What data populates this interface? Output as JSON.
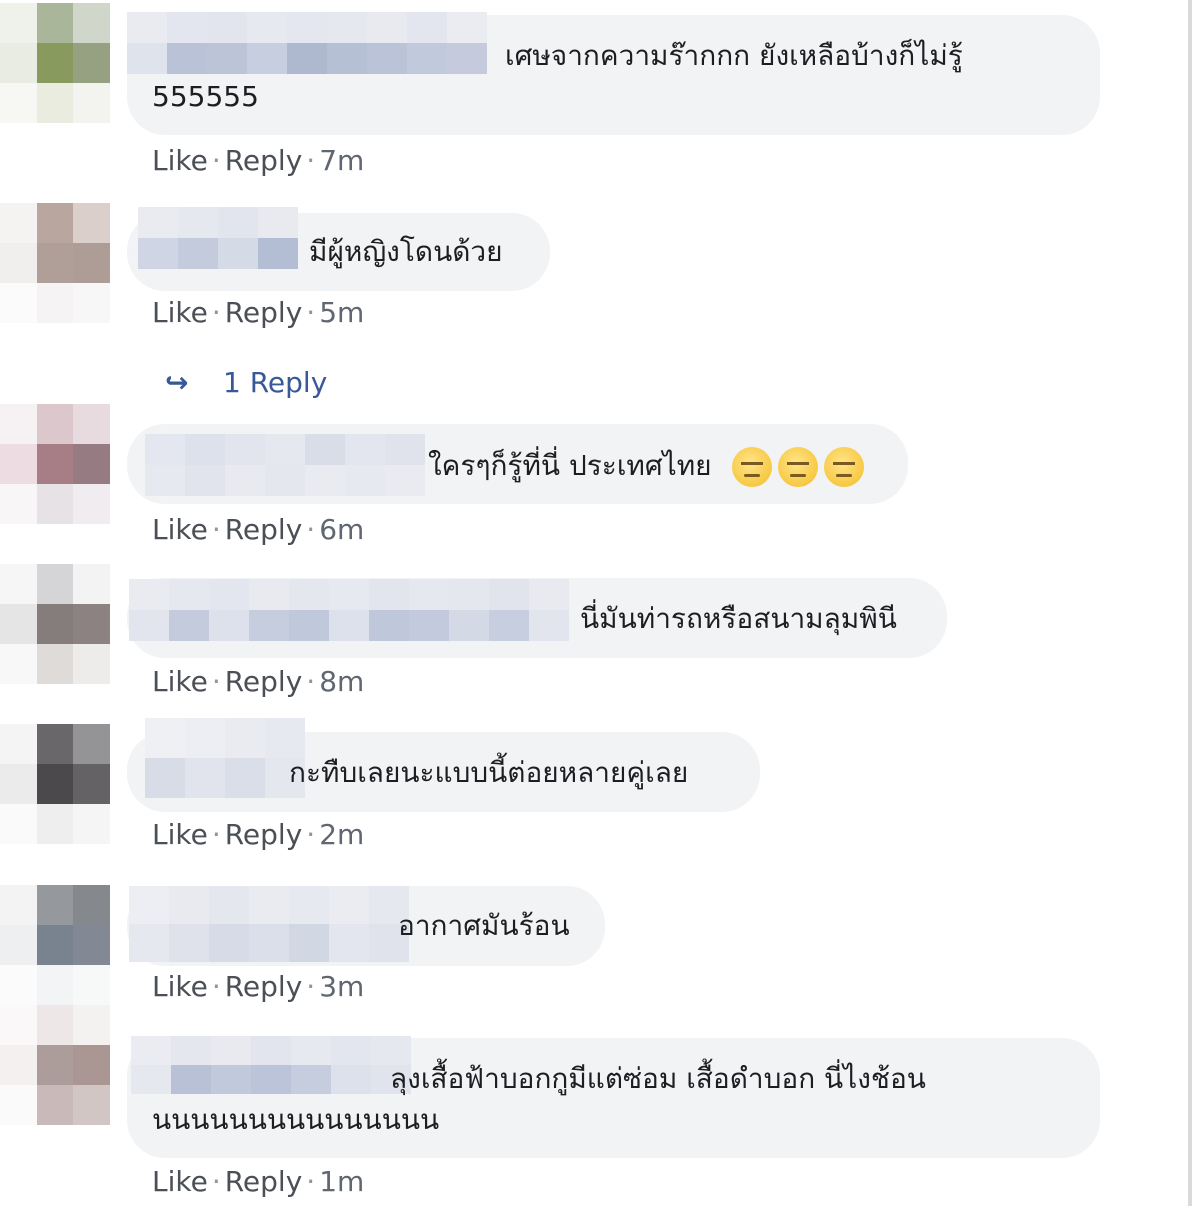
{
  "comments": [
    {
      "text_line1": "เศษจากความร๊ากกก ยังเหลือบ้างก็ไม่รู้",
      "text_line2": "555555",
      "like": "Like",
      "reply": "Reply",
      "sep": "·",
      "time": "7m"
    },
    {
      "text_line1": "มีผู้หญิงโดนด้วย",
      "like": "Like",
      "reply": "Reply",
      "sep": "·",
      "time": "5m"
    },
    {
      "text_line1": "ใครๆก็รู้ที่นี่ ประเทศไทย",
      "emojis": [
        "expressionless-face-icon",
        "expressionless-face-icon",
        "expressionless-face-icon"
      ],
      "like": "Like",
      "reply": "Reply",
      "sep": "·",
      "time": "6m"
    },
    {
      "text_line1": "นี่มันท่ารถหรือสนามลุมพินี",
      "like": "Like",
      "reply": "Reply",
      "sep": "·",
      "time": "8m"
    },
    {
      "text_line1": "กะทืบเลยนะแบบนี้ต่อยหลายคู่เลย",
      "like": "Like",
      "reply": "Reply",
      "sep": "·",
      "time": "2m"
    },
    {
      "text_line1": "อากาศมันร้อน",
      "like": "Like",
      "reply": "Reply",
      "sep": "·",
      "time": "3m"
    },
    {
      "text_line1": "ลุงเสื้อฟ้าบอกกูมีแต่ซ่อม เสื้อดำบอก นี่ไงช้อน",
      "text_line2": "นนนนนนนนนนนนนนน",
      "like": "Like",
      "reply": "Reply",
      "sep": "·",
      "time": "1m"
    }
  ],
  "replies_link": {
    "arrow": "↪",
    "label": "1 Reply"
  },
  "colors": {
    "bubble": "#f2f3f5",
    "link": "#385898",
    "meta": "#606770"
  }
}
